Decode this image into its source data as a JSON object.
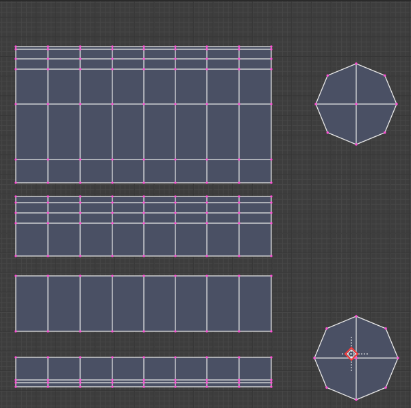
{
  "editor": {
    "type": "UV/Image Editor",
    "mode": "UV edit",
    "grid": true
  },
  "colors": {
    "background": "#3d3d3d",
    "grid_major": "#353535",
    "grid_minor": "#474747",
    "face_fill": "#4a5064",
    "edge": "#e8e8e8",
    "vertex": "#ff4fd6",
    "cursor_red": "#ff3a3a",
    "cursor_white": "#ffffff"
  },
  "islands": [
    {
      "name": "uv-island-large-strip",
      "columns": 8,
      "face_rows": 4
    },
    {
      "name": "uv-island-medium-strip",
      "columns": 8,
      "face_rows": 2
    },
    {
      "name": "uv-island-single-row-strip",
      "columns": 8,
      "face_rows": 1
    },
    {
      "name": "uv-island-bottom-strip",
      "columns": 8,
      "face_rows": 1
    },
    {
      "name": "uv-island-octagon-top",
      "sides": 8
    },
    {
      "name": "uv-island-octagon-bottom",
      "sides": 8
    }
  ],
  "cursor": {
    "icon": "2d-cursor-icon",
    "visible": true
  }
}
